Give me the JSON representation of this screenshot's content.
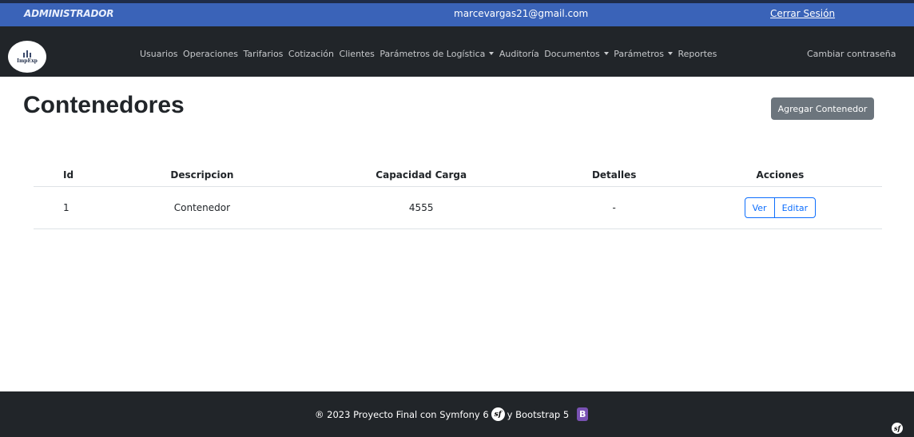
{
  "topbar": {
    "role": "ADMINISTRADOR",
    "email": "marcevargas21@gmail.com",
    "logout": "Cerrar Sesión"
  },
  "navbar": {
    "logo_text": "ImpExp",
    "items": [
      {
        "label": "Usuarios",
        "dropdown": false
      },
      {
        "label": "Operaciones",
        "dropdown": false
      },
      {
        "label": "Tarifarios",
        "dropdown": false
      },
      {
        "label": "Cotización",
        "dropdown": false
      },
      {
        "label": "Clientes",
        "dropdown": false
      },
      {
        "label": "Parámetros de Logística",
        "dropdown": true
      },
      {
        "label": "Auditoría",
        "dropdown": false
      },
      {
        "label": "Documentos",
        "dropdown": true
      },
      {
        "label": "Parámetros",
        "dropdown": true
      },
      {
        "label": "Reportes",
        "dropdown": false
      }
    ],
    "right_link": "Cambiar contraseña"
  },
  "main": {
    "title": "Contenedores",
    "add_button": "Agregar Contenedor",
    "table": {
      "headers": [
        "Id",
        "Descripcion",
        "Capacidad Carga",
        "Detalles",
        "Acciones"
      ],
      "rows": [
        {
          "id": "1",
          "descripcion": "Contenedor",
          "capacidad": "4555",
          "detalles": "-",
          "ver": "Ver",
          "editar": "Editar"
        }
      ]
    }
  },
  "footer": {
    "text_before": "® 2023 Proyecto Final con Symfony 6",
    "text_middle": "y Bootstrap 5",
    "symfony_mark": "sf",
    "bootstrap_mark": "B"
  },
  "colors": {
    "topbar": "#3a63b8",
    "navbar": "#212529",
    "primary_outline": "#0d6efd",
    "secondary_button": "#6c757d",
    "bootstrap_purple": "#7952b3"
  }
}
